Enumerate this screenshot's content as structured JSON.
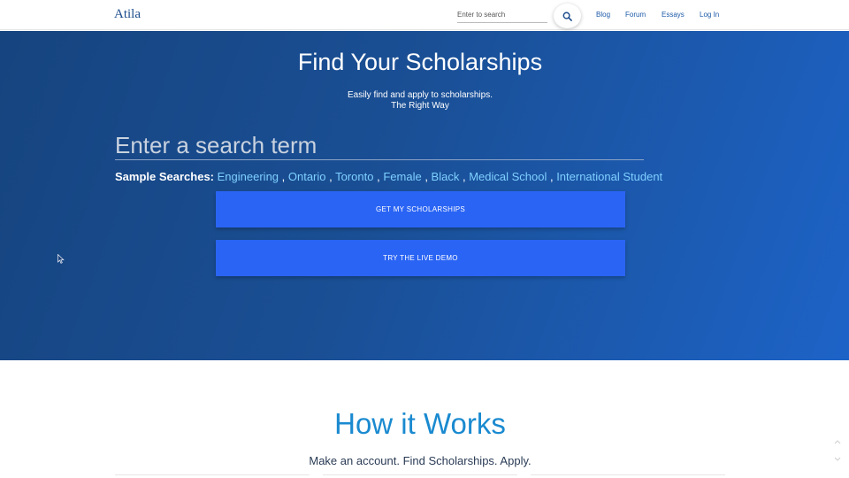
{
  "navbar": {
    "brand": "Atila",
    "search_placeholder": "Enter to search",
    "links": {
      "blog": "Blog",
      "forum": "Forum",
      "essays": "Essays",
      "login": "Log In"
    }
  },
  "hero": {
    "title": "Find Your Scholarships",
    "subtitle_line1": "Easily find and apply to scholarships.",
    "subtitle_line2": "The Right Way",
    "search_placeholder": "Enter a search term",
    "sample_label": "Sample Searches:",
    "samples": [
      "Engineering",
      "Ontario",
      "Toronto",
      "Female",
      "Black",
      "Medical School",
      "International Student"
    ],
    "get_button": "GET MY SCHOLARSHIPS",
    "demo_button": "TRY THE LIVE DEMO"
  },
  "how_it_works": {
    "title": "How it Works",
    "subtitle": "Make an account. Find Scholarships. Apply."
  },
  "colors": {
    "hero_start": "#16447f",
    "hero_end": "#1d63c7",
    "button": "#2a64f4",
    "link": "#7fd0ff",
    "how_title": "#1a8ad0"
  }
}
